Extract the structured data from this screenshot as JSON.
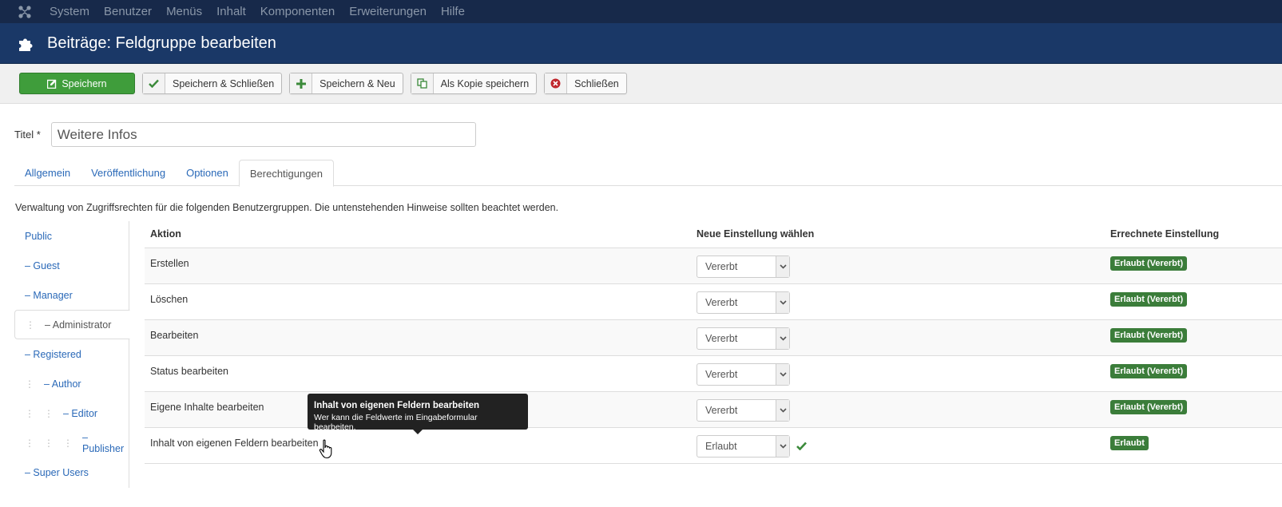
{
  "topnav": {
    "logo_icon": "joomla-logo-icon",
    "items": [
      "System",
      "Benutzer",
      "Menüs",
      "Inhalt",
      "Komponenten",
      "Erweiterungen",
      "Hilfe"
    ]
  },
  "header": {
    "icon": "puzzle-piece-icon",
    "title": "Beiträge: Feldgruppe bearbeiten"
  },
  "toolbar": {
    "save": "Speichern",
    "save_close": "Speichern & Schließen",
    "save_new": "Speichern & Neu",
    "save_copy": "Als Kopie speichern",
    "close": "Schließen"
  },
  "form": {
    "title_label": "Titel *",
    "title_value": "Weitere Infos"
  },
  "tabs": [
    "Allgemein",
    "Veröffentlichung",
    "Optionen",
    "Berechtigungen"
  ],
  "description": "Verwaltung von Zugriffsrechten für die folgenden Benutzergruppen. Die untenstehenden Hinweise sollten beachtet werden.",
  "groups": [
    {
      "label": "Public",
      "depth": 0
    },
    {
      "label": "– Guest",
      "depth": 0
    },
    {
      "label": "– Manager",
      "depth": 0
    },
    {
      "label": "– Administrator",
      "depth": 1,
      "active": true
    },
    {
      "label": "– Registered",
      "depth": 0
    },
    {
      "label": "– Author",
      "depth": 1
    },
    {
      "label": "– Editor",
      "depth": 2
    },
    {
      "label": "– Publisher",
      "depth": 3
    },
    {
      "label": "– Super Users",
      "depth": 0
    }
  ],
  "table": {
    "headers": {
      "action": "Aktion",
      "new_setting": "Neue Einstellung wählen",
      "calculated": "Errechnete Einstellung"
    },
    "rows": [
      {
        "action": "Erstellen",
        "select": "Vererbt",
        "calc": "Erlaubt (Vererbt)"
      },
      {
        "action": "Löschen",
        "select": "Vererbt",
        "calc": "Erlaubt (Vererbt)"
      },
      {
        "action": "Bearbeiten",
        "select": "Vererbt",
        "calc": "Erlaubt (Vererbt)"
      },
      {
        "action": "Status bearbeiten",
        "select": "Vererbt",
        "calc": "Erlaubt (Vererbt)"
      },
      {
        "action": "Eigene Inhalte bearbeiten",
        "select": "Vererbt",
        "calc": "Erlaubt (Vererbt)"
      },
      {
        "action": "Inhalt von eigenen Feldern bearbeiten",
        "select": "Erlaubt",
        "calc": "Erlaubt",
        "saved": true
      }
    ]
  },
  "tooltip": {
    "title": "Inhalt von eigenen Feldern bearbeiten",
    "body": "Wer kann die Feldwerte im Eingabeformular bearbeiten."
  },
  "colors": {
    "topnav_bg": "#17294a",
    "header_bg": "#1a3867",
    "save_green": "#3f9d3b",
    "badge_green": "#3b7d3a",
    "link_blue": "#2a69b8"
  }
}
